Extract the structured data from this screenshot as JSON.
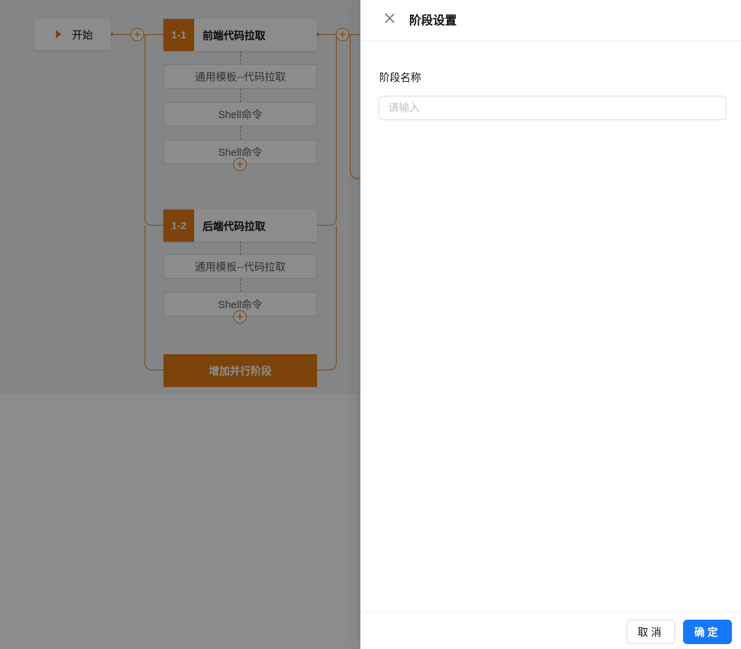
{
  "pipeline": {
    "start_label": "开始",
    "stages": [
      {
        "number": "1-1",
        "title": "前端代码拉取",
        "tasks": [
          "通用模板--代码拉取",
          "Shell命令",
          "Shell命令"
        ]
      },
      {
        "number": "1-2",
        "title": "后端代码拉取",
        "tasks": [
          "通用模板--代码拉取",
          "Shell命令"
        ]
      }
    ],
    "add_parallel_label": "增加并行阶段",
    "plus_symbol": "+"
  },
  "drawer": {
    "title": "阶段设置",
    "field_label": "阶段名称",
    "field_value": "",
    "field_placeholder": "请输入",
    "cancel_label": "取消",
    "ok_label": "确定"
  },
  "colors": {
    "accent": "#e27a14",
    "primary": "#1677ff"
  }
}
